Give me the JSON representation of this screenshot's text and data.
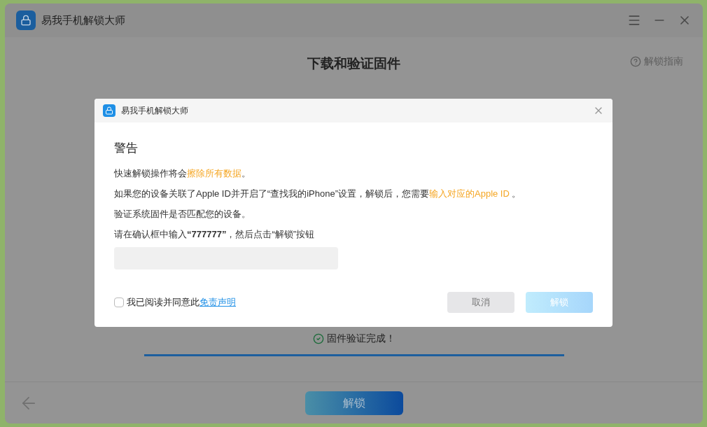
{
  "window": {
    "title": "易我手机解锁大师"
  },
  "page": {
    "title": "下载和验证固件",
    "help_link": "解锁指南",
    "status": "固件验证完成！",
    "progress": {
      "level": 1
    },
    "unlock_button": "解锁"
  },
  "dialog": {
    "title": "易我手机解锁大师",
    "heading": "警告",
    "paragraphs": [
      [
        {
          "text": "快速解锁操作将会",
          "highlight": false
        },
        {
          "text": "擦除所有数据",
          "highlight": true
        },
        {
          "text": "。",
          "highlight": false
        }
      ],
      [
        {
          "text": "如果您的设备关联了Apple ID并开启了“查找我的iPhone”设置，解锁后，您需要",
          "highlight": false
        },
        {
          "text": "输入对应的Apple ID ",
          "highlight": true
        },
        {
          "text": "。",
          "highlight": false
        }
      ],
      [
        {
          "text": "验证系统固件是否匹配您的设备。",
          "highlight": false
        }
      ],
      [
        {
          "text": "请在确认框中输入**“777777”**，然后点击“解锁”按钮",
          "highlight": false
        }
      ]
    ],
    "agree": {
      "label": "我已阅读并同意此",
      "link": "免责声明",
      "checked": false
    },
    "buttons": [
      {
        "label": "取消",
        "kind": "cancel",
        "disabled": false
      },
      {
        "label": "解锁",
        "kind": "confirm",
        "disabled": true
      }
    ]
  }
}
